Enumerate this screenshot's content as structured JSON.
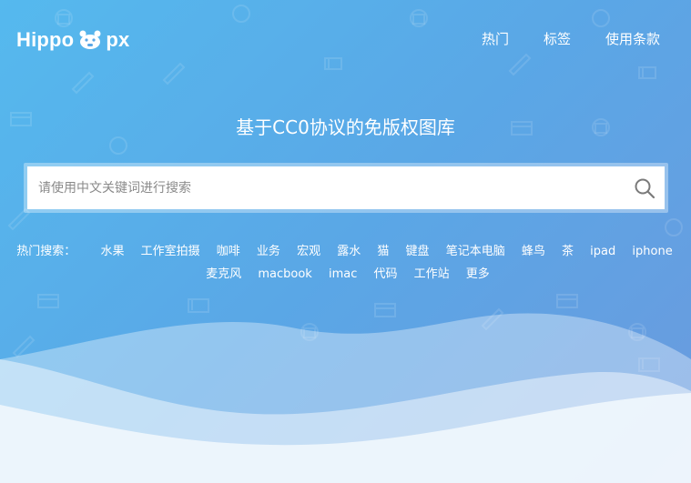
{
  "header": {
    "logo_text_left": "Hippo",
    "logo_text_right": "px",
    "nav": [
      {
        "label": "热门"
      },
      {
        "label": "标签"
      },
      {
        "label": "使用条款"
      }
    ]
  },
  "hero": {
    "headline": "基于CC0协议的免版权图库"
  },
  "search": {
    "placeholder": "请使用中文关键词进行搜索",
    "value": "",
    "button_icon": "search-icon"
  },
  "hot_searches": {
    "label": "热门搜索：",
    "tags": [
      "水果",
      "工作室拍摄",
      "咖啡",
      "业务",
      "宏观",
      "露水",
      "猫",
      "键盘",
      "笔记本电脑",
      "蜂鸟",
      "茶",
      "ipad",
      "iphone",
      "麦克风",
      "macbook",
      "imac",
      "代码",
      "工作站",
      "更多"
    ]
  },
  "colors": {
    "bg_start": "#55b9ee",
    "bg_end": "#6b9ade",
    "text": "#ffffff"
  }
}
